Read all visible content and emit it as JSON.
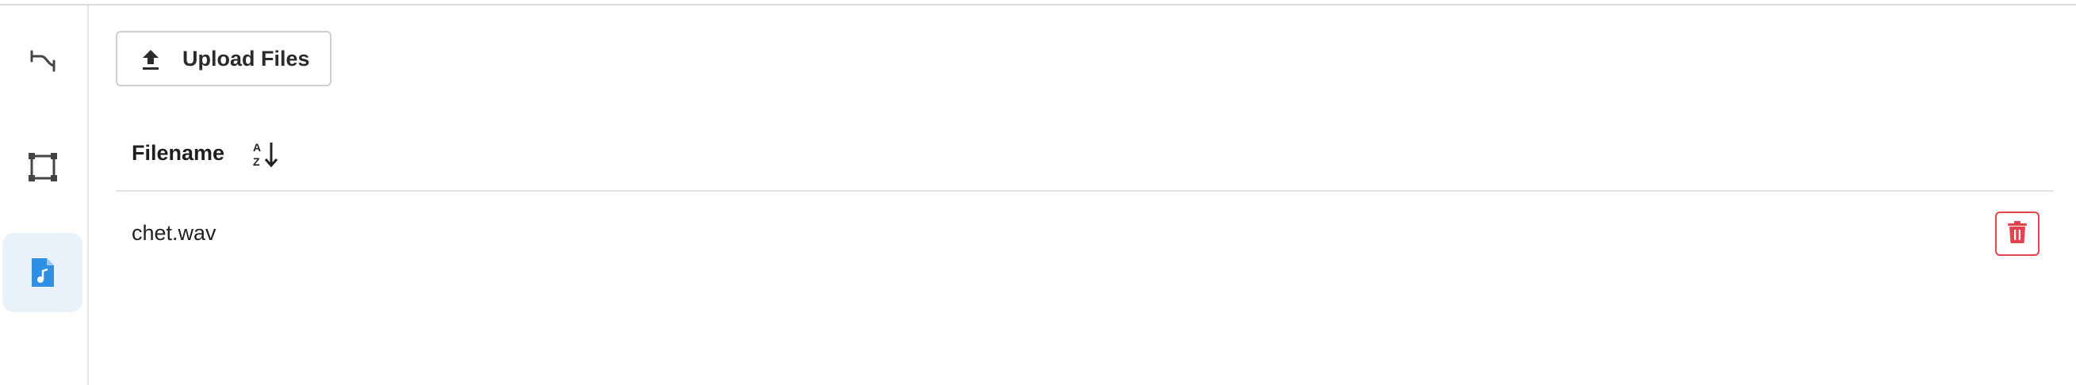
{
  "sidebar": {
    "items": [
      {
        "icon": "route-icon",
        "active": false
      },
      {
        "icon": "bounding-box-icon",
        "active": false
      },
      {
        "icon": "audio-file-icon",
        "active": true
      }
    ]
  },
  "toolbar": {
    "upload_label": "Upload Files",
    "upload_icon": "upload-icon"
  },
  "table": {
    "columns": [
      {
        "label": "Filename",
        "sort_icon": "sort-alpha-down-icon"
      }
    ],
    "rows": [
      {
        "filename": "chet.wav",
        "action_icon": "trash-icon"
      }
    ]
  },
  "colors": {
    "accent": "#2f8fe3",
    "active_bg": "#e9f2fb",
    "danger": "#e5434b",
    "icon_dark": "#444444"
  }
}
